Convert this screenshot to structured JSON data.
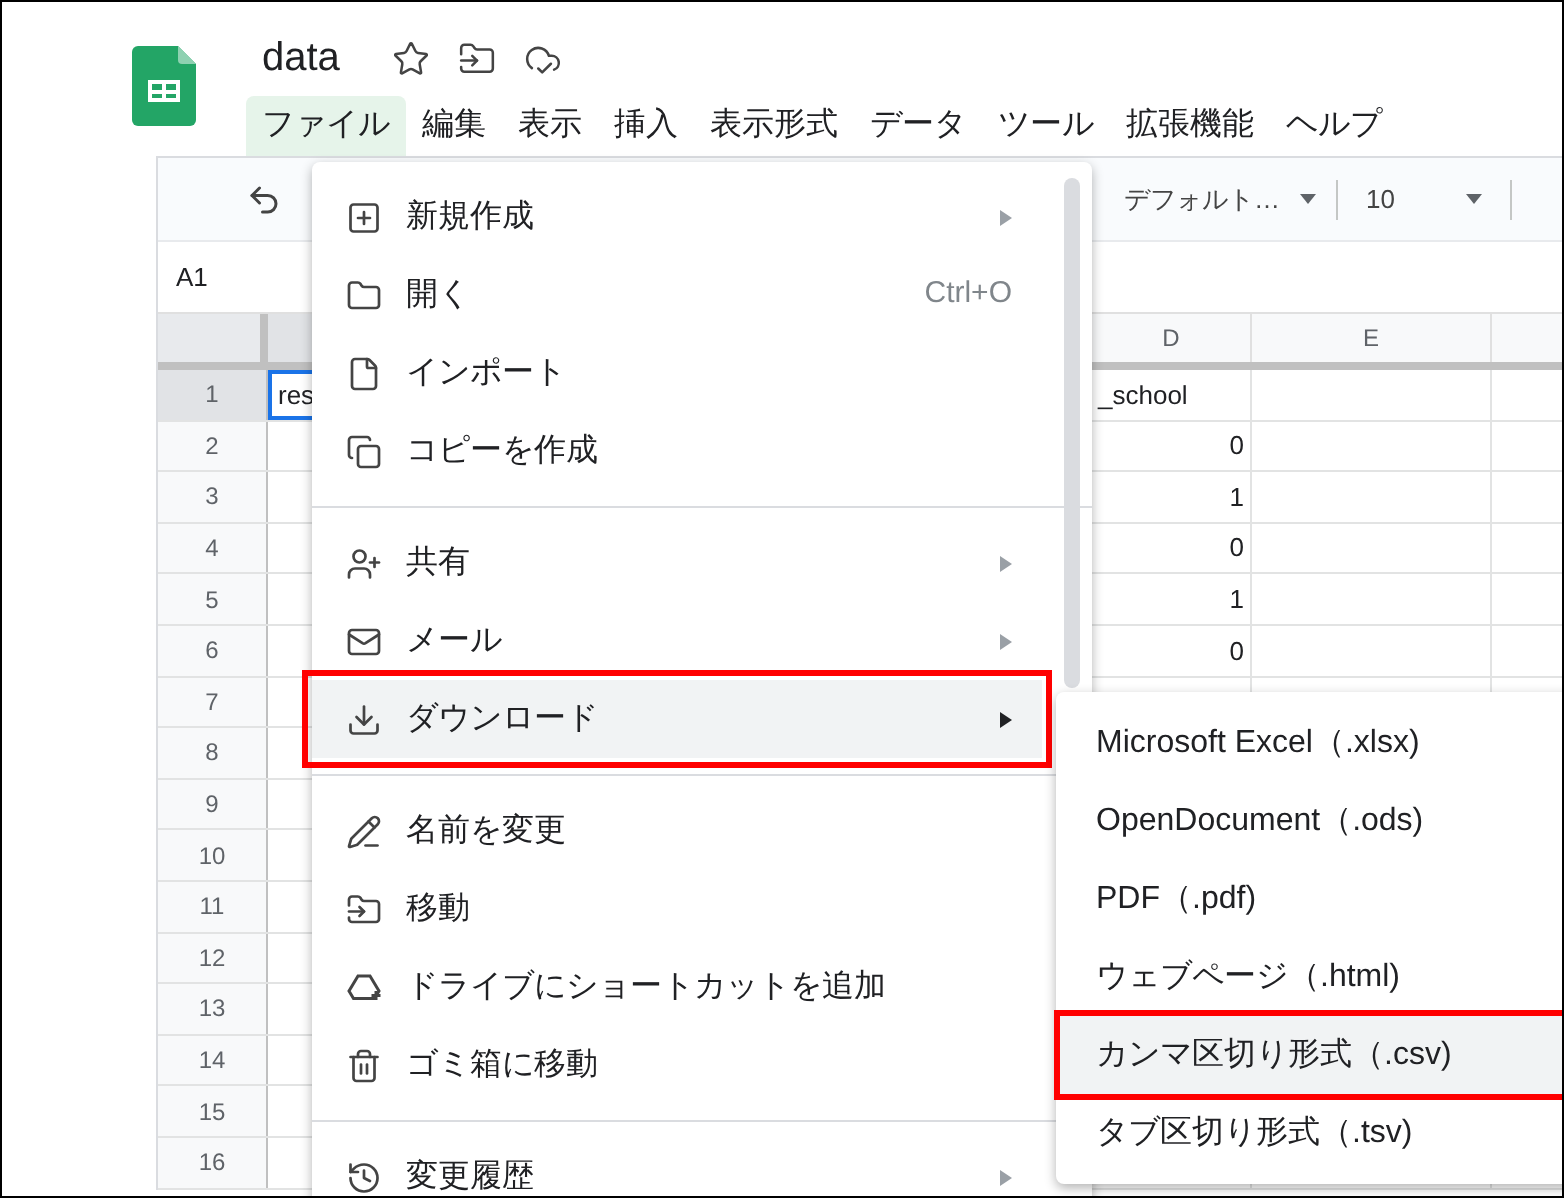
{
  "document": {
    "title": "data"
  },
  "menu_bar": [
    {
      "label": "ファイル",
      "selected": true
    },
    {
      "label": "編集",
      "selected": false
    },
    {
      "label": "表示",
      "selected": false
    },
    {
      "label": "挿入",
      "selected": false
    },
    {
      "label": "表示形式",
      "selected": false
    },
    {
      "label": "データ",
      "selected": false
    },
    {
      "label": "ツール",
      "selected": false
    },
    {
      "label": "拡張機能",
      "selected": false
    },
    {
      "label": "ヘルプ",
      "selected": false
    }
  ],
  "toolbar": {
    "font": "デフォルト…",
    "font_size": "10"
  },
  "name_box": "A1",
  "sheet": {
    "column_headers": [
      "D",
      "E"
    ],
    "header_row": {
      "number": "1",
      "cell_a": "res",
      "selected": true,
      "cell_d": "_school"
    },
    "rows": [
      {
        "number": "2",
        "cell_d": "0"
      },
      {
        "number": "3",
        "cell_d": "1"
      },
      {
        "number": "4",
        "cell_d": "0"
      },
      {
        "number": "5",
        "cell_d": "1"
      },
      {
        "number": "6",
        "cell_d": "0"
      },
      {
        "number": "7"
      },
      {
        "number": "8"
      },
      {
        "number": "9"
      },
      {
        "number": "10"
      },
      {
        "number": "11"
      },
      {
        "number": "12"
      },
      {
        "number": "13"
      },
      {
        "number": "14"
      },
      {
        "number": "15"
      },
      {
        "number": "16"
      }
    ]
  },
  "file_menu": {
    "sections": [
      [
        {
          "label": "新規作成",
          "has_submenu": true,
          "selected": false
        },
        {
          "label": "開く",
          "shortcut": "Ctrl+O",
          "selected": false
        },
        {
          "label": "インポート",
          "selected": false
        },
        {
          "label": "コピーを作成",
          "selected": false
        }
      ],
      [
        {
          "label": "共有",
          "has_submenu": true,
          "selected": false
        },
        {
          "label": "メール",
          "has_submenu": true,
          "selected": false
        },
        {
          "label": "ダウンロード",
          "has_submenu": true,
          "selected": true
        }
      ],
      [
        {
          "label": "名前を変更",
          "selected": false
        },
        {
          "label": "移動",
          "selected": false
        },
        {
          "label": "ドライブにショートカットを追加",
          "selected": false
        },
        {
          "label": "ゴミ箱に移動",
          "selected": false
        }
      ],
      [
        {
          "label": "変更履歴",
          "has_submenu": true,
          "selected": false
        }
      ]
    ]
  },
  "download_submenu": [
    {
      "label": "Microsoft Excel（.xlsx)",
      "selected": false
    },
    {
      "label": "OpenDocument（.ods)",
      "selected": false
    },
    {
      "label": "PDF（.pdf)",
      "selected": false
    },
    {
      "label": "ウェブページ（.html)",
      "selected": false
    },
    {
      "label": "カンマ区切り形式（.csv)",
      "selected": true
    },
    {
      "label": "タブ区切り形式（.tsv)",
      "selected": false
    }
  ]
}
